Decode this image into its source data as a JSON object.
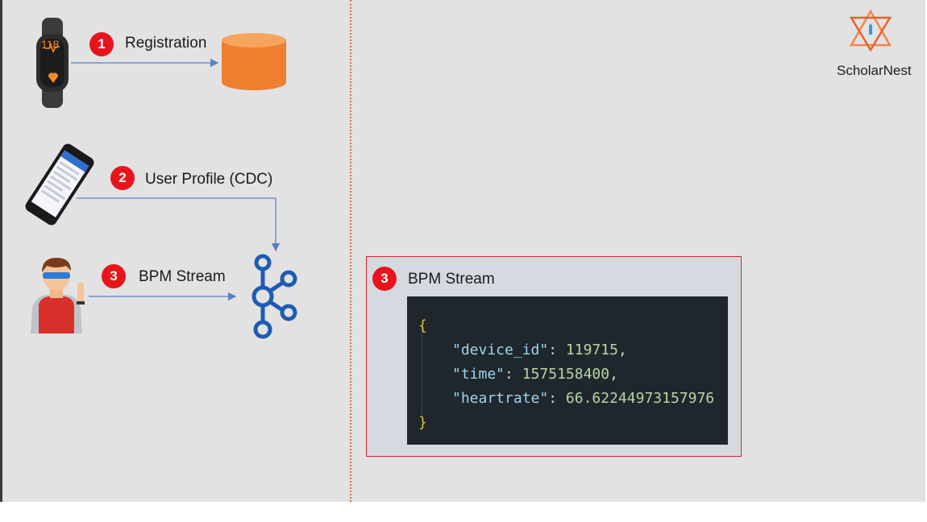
{
  "brand": {
    "name": "ScholarNest"
  },
  "steps": [
    {
      "number": "1",
      "label": "Registration"
    },
    {
      "number": "2",
      "label": "User Profile (CDC)"
    },
    {
      "number": "3",
      "label": "BPM Stream"
    }
  ],
  "devices": {
    "watch_reading": "118"
  },
  "message": {
    "number": "3",
    "title": "BPM Stream",
    "open_brace": "{",
    "close_brace": "}",
    "fields": [
      {
        "key": "\"device_id\"",
        "value": "119715",
        "sep": ": ",
        "end": ","
      },
      {
        "key": "\"time\"",
        "value": "1575158400",
        "sep": ": ",
        "end": ","
      },
      {
        "key": "\"heartrate\"",
        "value": "66.62244973157976",
        "sep": ": ",
        "end": ""
      }
    ]
  },
  "colors": {
    "badge": "#e8141c",
    "database": "#ef7f2f",
    "kafka": "#1e5bb4",
    "connector": "#5b7fc7",
    "panel_border": "#d8262f",
    "code_bg": "#1f272c"
  },
  "icons": [
    "fitness-band-icon",
    "database-icon",
    "smartphone-icon",
    "user-avatar-icon",
    "kafka-icon",
    "scholarnest-logo-icon"
  ]
}
